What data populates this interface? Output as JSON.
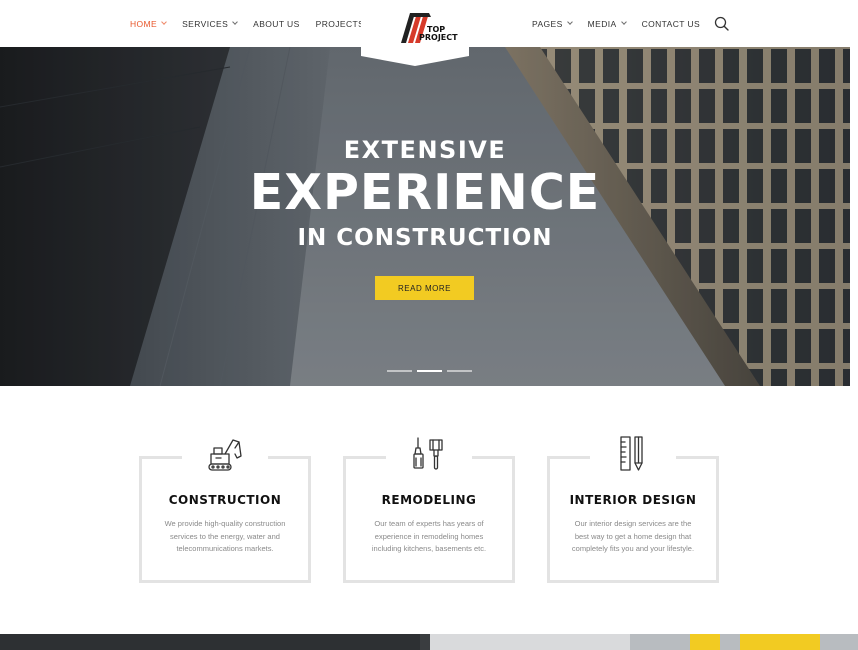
{
  "nav": {
    "left": [
      {
        "label": "HOME",
        "active": true,
        "dropdown": true
      },
      {
        "label": "SERVICES",
        "active": false,
        "dropdown": true
      },
      {
        "label": "ABOUT US",
        "active": false,
        "dropdown": false
      },
      {
        "label": "PROJECTS",
        "active": false,
        "dropdown": true
      }
    ],
    "right": [
      {
        "label": "PAGES",
        "active": false,
        "dropdown": true
      },
      {
        "label": "MEDIA",
        "active": false,
        "dropdown": true
      },
      {
        "label": "CONTACT US",
        "active": false,
        "dropdown": false
      }
    ],
    "search_icon": "search-icon"
  },
  "logo": {
    "line1": "TOP",
    "line2": "PROJECT"
  },
  "hero": {
    "line1": "EXTENSIVE",
    "line2": "EXPERIENCE",
    "line3": "IN CONSTRUCTION",
    "button": "READ MORE",
    "slides": 3,
    "active_slide": 2
  },
  "services": [
    {
      "icon": "excavator-icon",
      "title": "CONSTRUCTION",
      "desc": "We provide high-quality construction services to the energy, water and telecommunications markets."
    },
    {
      "icon": "paint-tools-icon",
      "title": "REMODELING",
      "desc": "Our team of experts has years of experience in remodeling homes including kitchens, basements etc."
    },
    {
      "icon": "ruler-pencil-icon",
      "title": "INTERIOR DESIGN",
      "desc": "Our interior design services are the best way to get a home design that completely fits you and your lifestyle."
    }
  ],
  "colors": {
    "accent": "#e8572b",
    "button": "#f2cb22",
    "logo_red": "#d63a2a",
    "logo_dark": "#222222"
  }
}
